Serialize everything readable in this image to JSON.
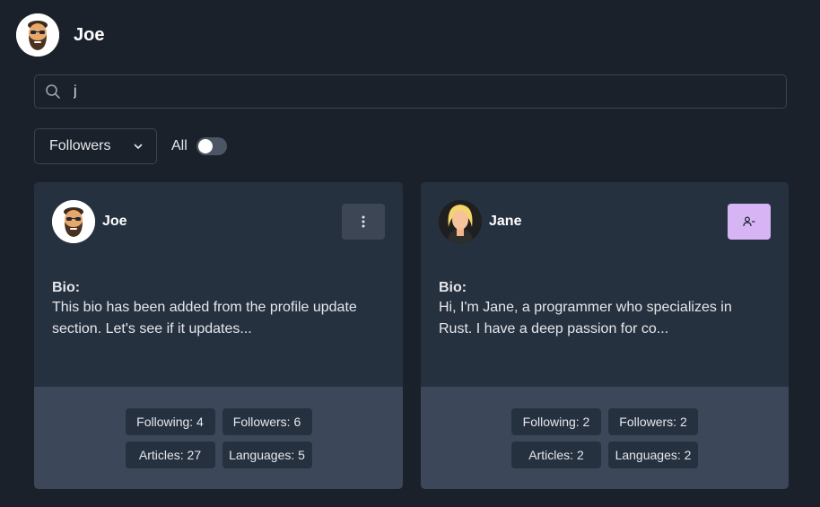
{
  "header": {
    "user_name": "Joe",
    "avatar_icon": "bearded-man-avatar-icon"
  },
  "search": {
    "value": "j",
    "icon": "search-icon"
  },
  "filters": {
    "select_value": "Followers",
    "toggle_label": "All",
    "toggle_on": false
  },
  "cards": [
    {
      "name": "Joe",
      "avatar_icon": "bearded-man-avatar-icon",
      "action_icon": "more-vertical-icon",
      "bio_label": "Bio:",
      "bio": "This bio has been added from the profile update section. Let's see if it updates...",
      "stats": {
        "following": "Following: 4",
        "followers": "Followers: 6",
        "articles": "Articles: 27",
        "languages": "Languages: 5"
      }
    },
    {
      "name": "Jane",
      "avatar_icon": "blonde-woman-avatar-icon",
      "action_icon": "user-minus-icon",
      "bio_label": "Bio:",
      "bio": "Hi, I'm Jane, a programmer who specializes in Rust. I have a deep passion for co...",
      "stats": {
        "following": "Following: 2",
        "followers": "Followers: 2",
        "articles": "Articles: 2",
        "languages": "Languages: 2"
      }
    }
  ],
  "colors": {
    "background": "#1b212b",
    "card": "#263140",
    "card_footer": "#3c4859",
    "unfollow_button": "#d7b5f5"
  }
}
